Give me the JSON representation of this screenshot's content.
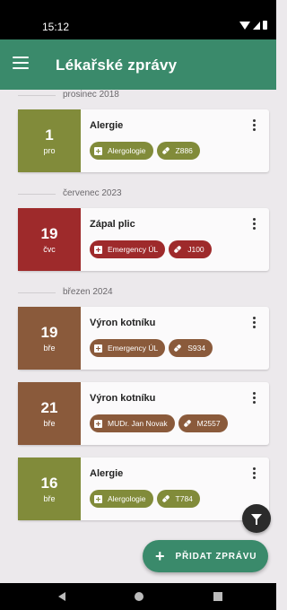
{
  "status_bar": {
    "time": "15:12"
  },
  "app_bar": {
    "title": "Lékařské zprávy"
  },
  "sections": [
    {
      "label": "prosinec 2018",
      "reports": [
        {
          "day": "1",
          "month": "pro",
          "name": "Alergie",
          "color": "#818b3a",
          "provider": "Alergologie",
          "provider_icon": "plus-square-icon",
          "code": "Z886"
        }
      ]
    },
    {
      "label": "červenec 2023",
      "reports": [
        {
          "day": "19",
          "month": "čvc",
          "name": "Zápal plic",
          "color": "#9e2a2b",
          "provider": "Emergency ÚL",
          "provider_icon": "plus-square-icon",
          "code": "J100"
        }
      ]
    },
    {
      "label": "březen 2024",
      "reports": [
        {
          "day": "19",
          "month": "bře",
          "name": "Výron kotníku",
          "color": "#8a5a3b",
          "provider": "Emergency ÚL",
          "provider_icon": "plus-square-icon",
          "code": "S934"
        },
        {
          "day": "21",
          "month": "bře",
          "name": "Výron kotníku",
          "color": "#8a5a3b",
          "provider": "MUDr. Jan Novak",
          "provider_icon": "plus-square-icon",
          "code": "M2557"
        },
        {
          "day": "16",
          "month": "bře",
          "name": "Alergie",
          "color": "#818b3a",
          "provider": "Alergologie",
          "provider_icon": "plus-square-icon",
          "code": "T784"
        }
      ]
    }
  ],
  "fab": {
    "add_label": "PŘIDAT ZPRÁVU",
    "add_icon": "plus-icon",
    "filter_icon": "filter-icon"
  },
  "colors": {
    "primary": "#3a8a6b",
    "background": "#ece9ec"
  }
}
